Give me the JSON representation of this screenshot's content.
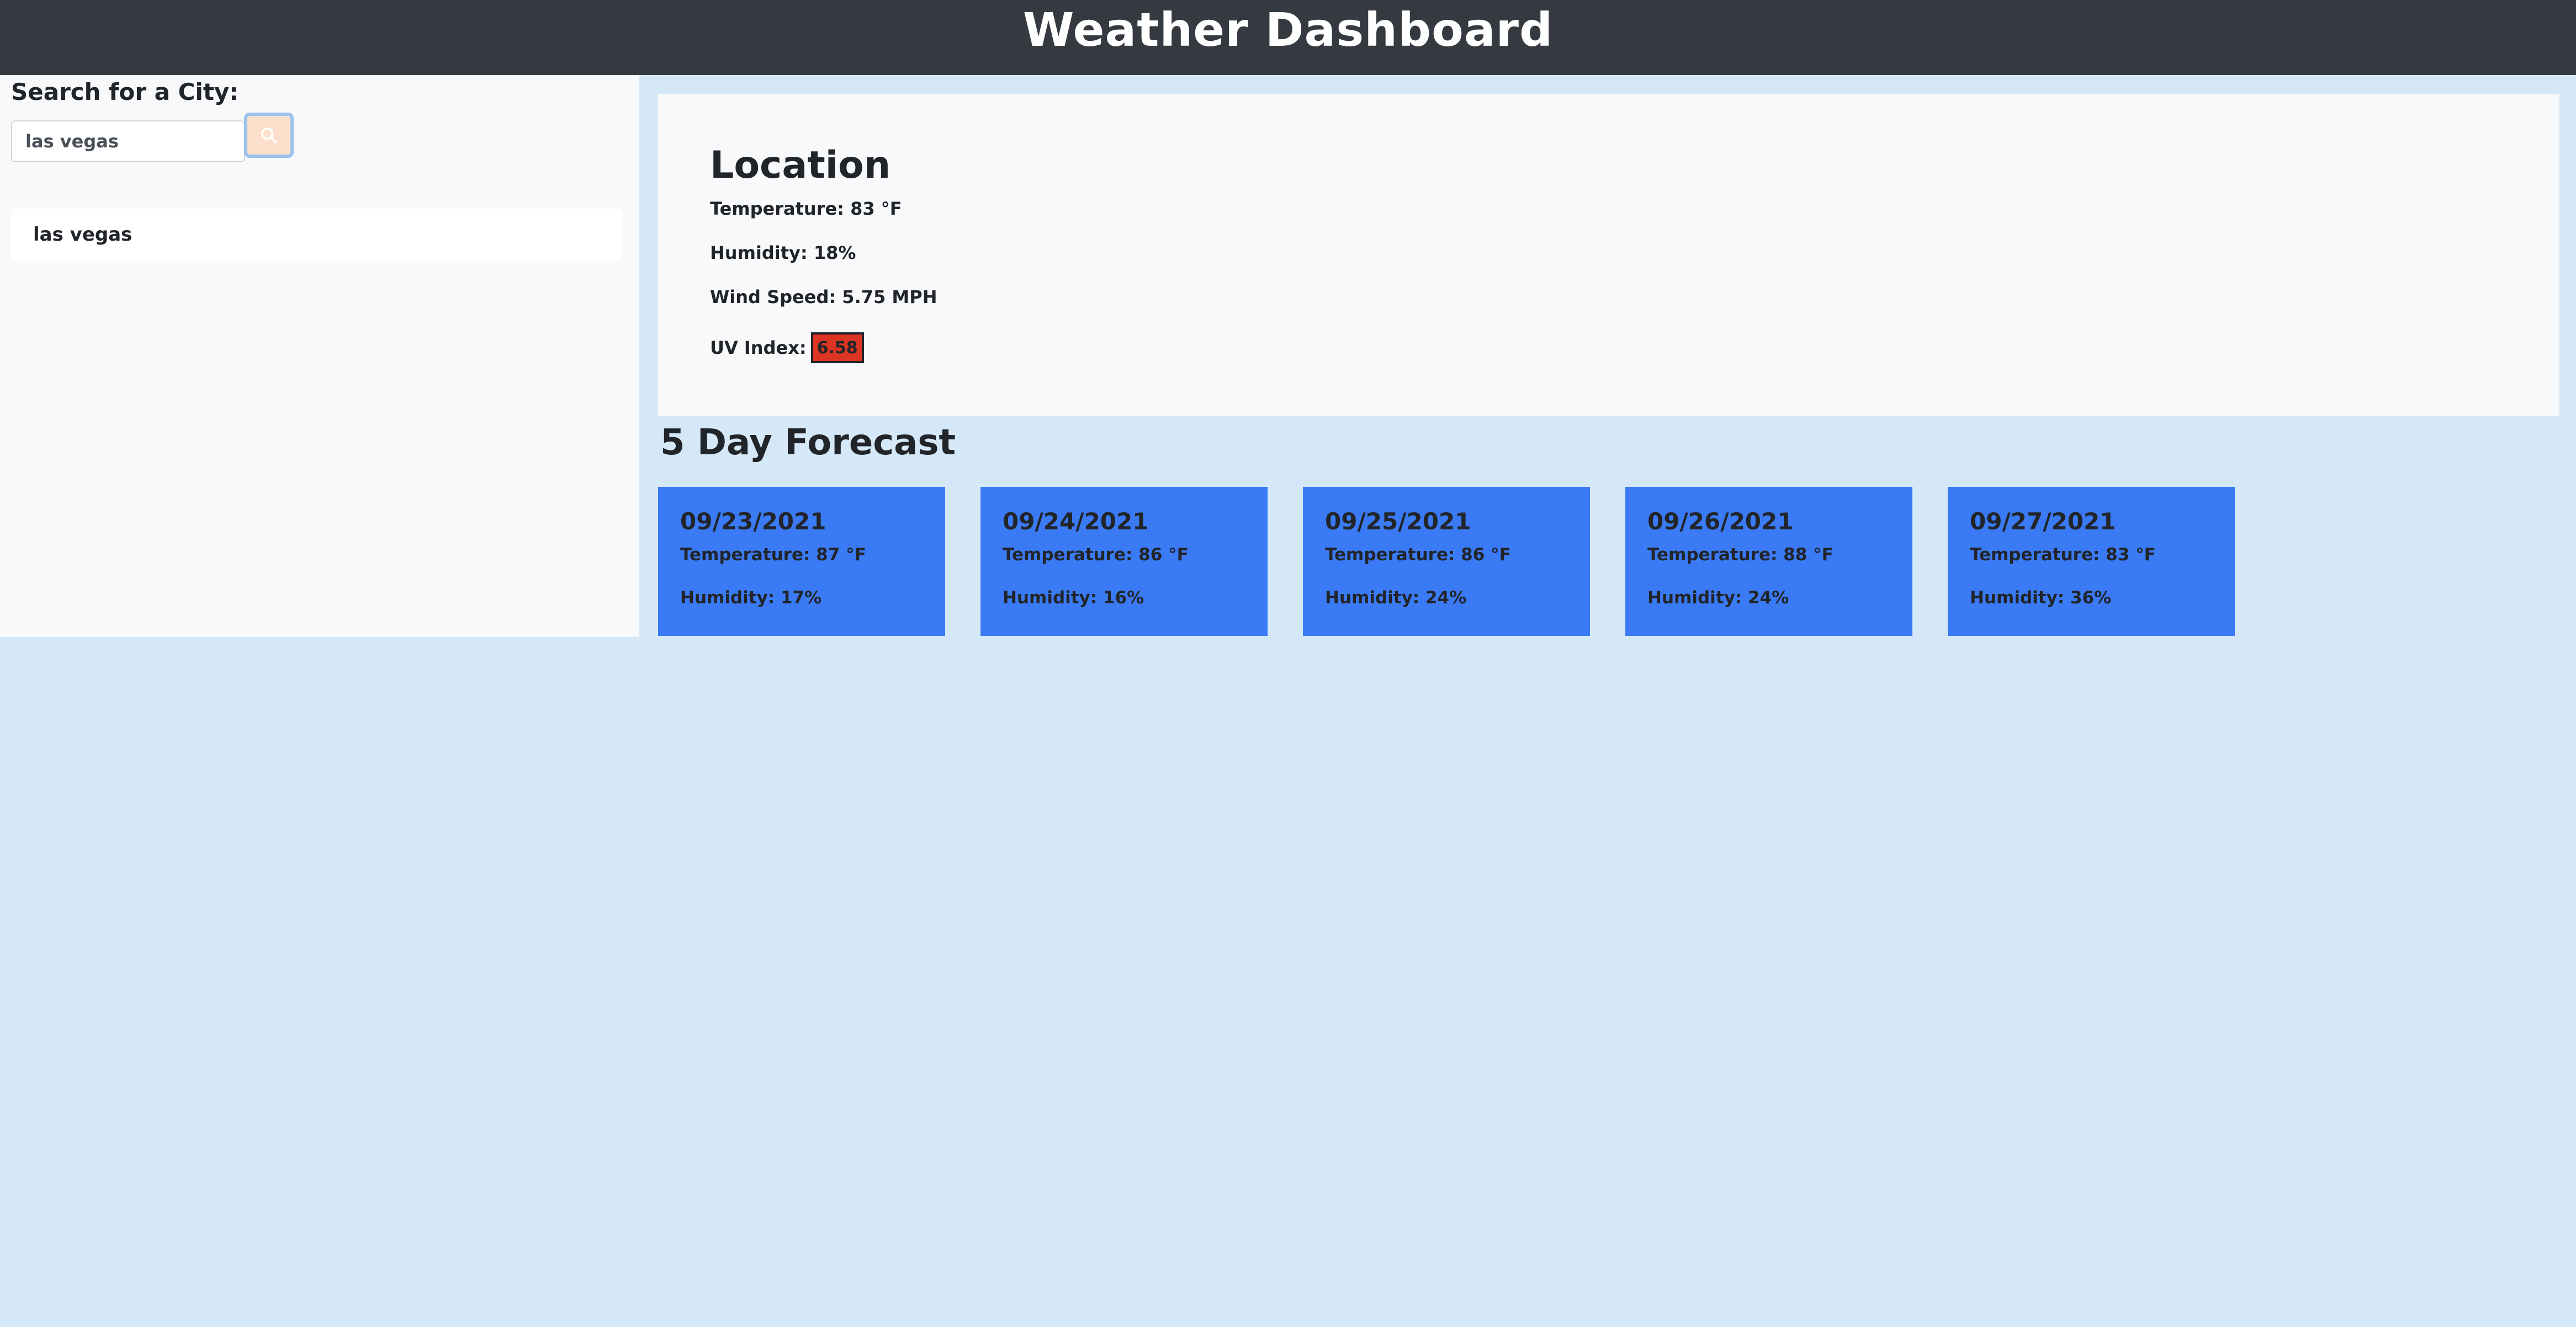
{
  "header": {
    "title": "Weather Dashboard"
  },
  "sidebar": {
    "search_label": "Search for a City:",
    "search_value": "las vegas",
    "search_button_icon": "search-icon",
    "history": [
      {
        "label": "las vegas"
      }
    ]
  },
  "current": {
    "location": "Location",
    "temperature": "Temperature: 83 °F",
    "humidity": "Humidity: 18%",
    "wind": "Wind Speed: 5.75 MPH",
    "uv_label": "UV Index:",
    "uv_value": "6.58",
    "uv_color": "#dc3524"
  },
  "forecast": {
    "heading": "5 Day Forecast",
    "days": [
      {
        "date": "09/23/2021",
        "temperature": "Temperature: 87 °F",
        "humidity": "Humidity: 17%"
      },
      {
        "date": "09/24/2021",
        "temperature": "Temperature: 86 °F",
        "humidity": "Humidity: 16%"
      },
      {
        "date": "09/25/2021",
        "temperature": "Temperature: 86 °F",
        "humidity": "Humidity: 24%"
      },
      {
        "date": "09/26/2021",
        "temperature": "Temperature: 88 °F",
        "humidity": "Humidity: 24%"
      },
      {
        "date": "09/27/2021",
        "temperature": "Temperature: 83 °F",
        "humidity": "Humidity: 36%"
      }
    ],
    "card_color": "#3b7af5"
  },
  "colors": {
    "header_bg": "#343a40",
    "page_bg": "#d4e8f8",
    "panel_bg": "#f8f9fa"
  }
}
